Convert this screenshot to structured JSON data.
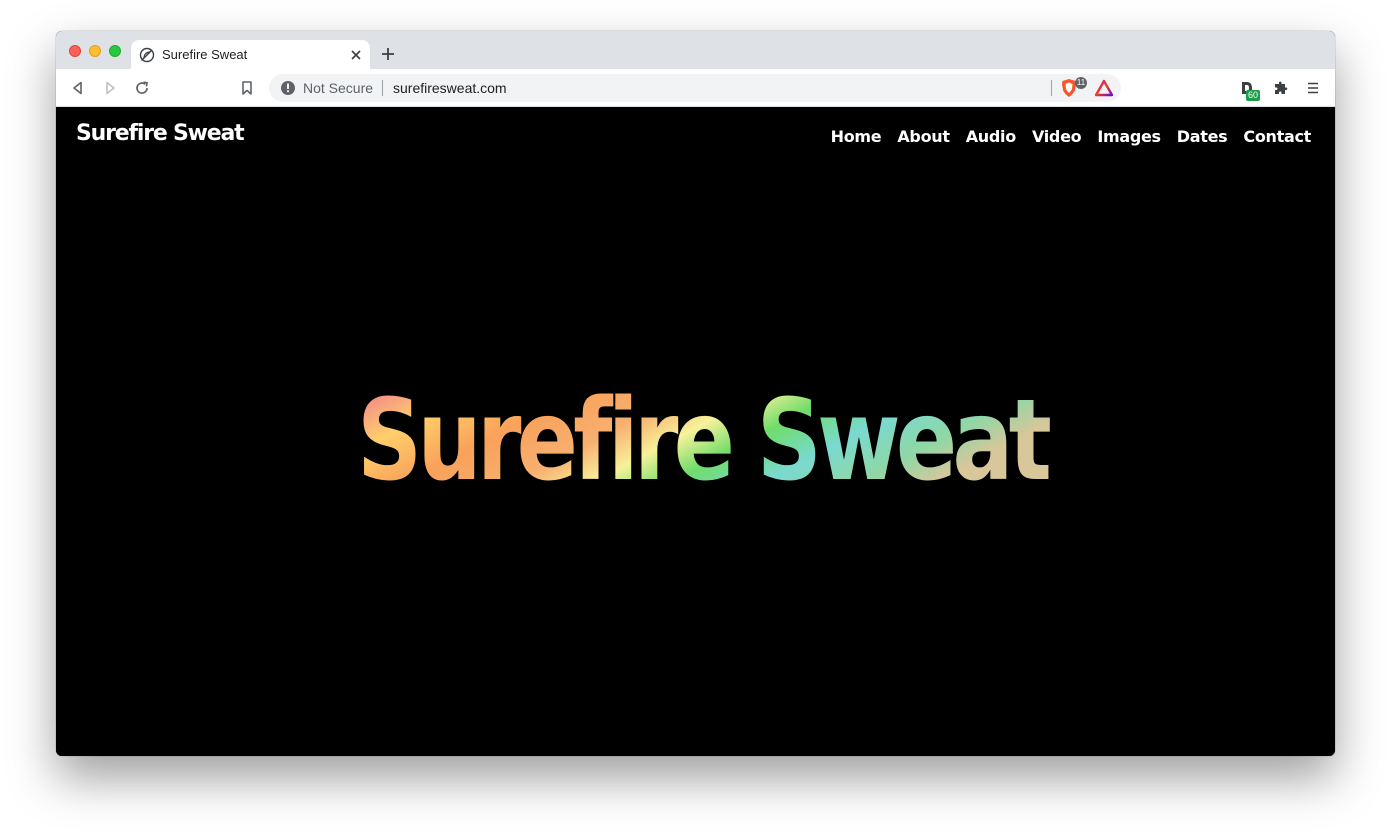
{
  "browser": {
    "tab": {
      "title": "Surefire Sweat",
      "favicon": "leaf-icon"
    },
    "toolbar": {
      "security_label": "Not Secure",
      "url": "surefiresweat.com",
      "shields_count": "11",
      "extension_badge": "60"
    },
    "icons": [
      "back-icon",
      "forward-icon",
      "reload-icon",
      "bookmark-icon",
      "info-icon",
      "brave-shields-icon",
      "brave-rewards-icon",
      "extension-d-icon",
      "puzzle-icon",
      "menu-icon",
      "close-icon",
      "plus-icon"
    ]
  },
  "site": {
    "logo": "Surefire Sweat",
    "nav": [
      "Home",
      "About",
      "Audio",
      "Video",
      "Images",
      "Dates",
      "Contact"
    ],
    "hero_title": "Surefire Sweat"
  },
  "colors": {
    "page_background": "#000000",
    "nav_text": "#ffffff",
    "hero_gradient": [
      "#f28a8a",
      "#f8e27a",
      "#f9a15a",
      "#ffcf6b",
      "#f7f29a",
      "#6fdc6a",
      "#7ad9d0",
      "#8fd7a5",
      "#d7c79a"
    ]
  }
}
